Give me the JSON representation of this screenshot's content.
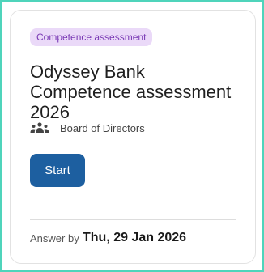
{
  "card": {
    "badge": "Competence assessment",
    "title": "Odyssey Bank Competence assessment 2026",
    "audience_icon": "group-people-icon",
    "audience": "Board of Directors",
    "start_label": "Start",
    "answer_by_label": "Answer by",
    "answer_by_date": "Thu, 29 Jan 2026"
  },
  "colors": {
    "badge_bg": "#ead9f8",
    "badge_text": "#7a3ab5",
    "button_bg": "#1d5fa0",
    "frame_border": "#4fd4bb"
  }
}
